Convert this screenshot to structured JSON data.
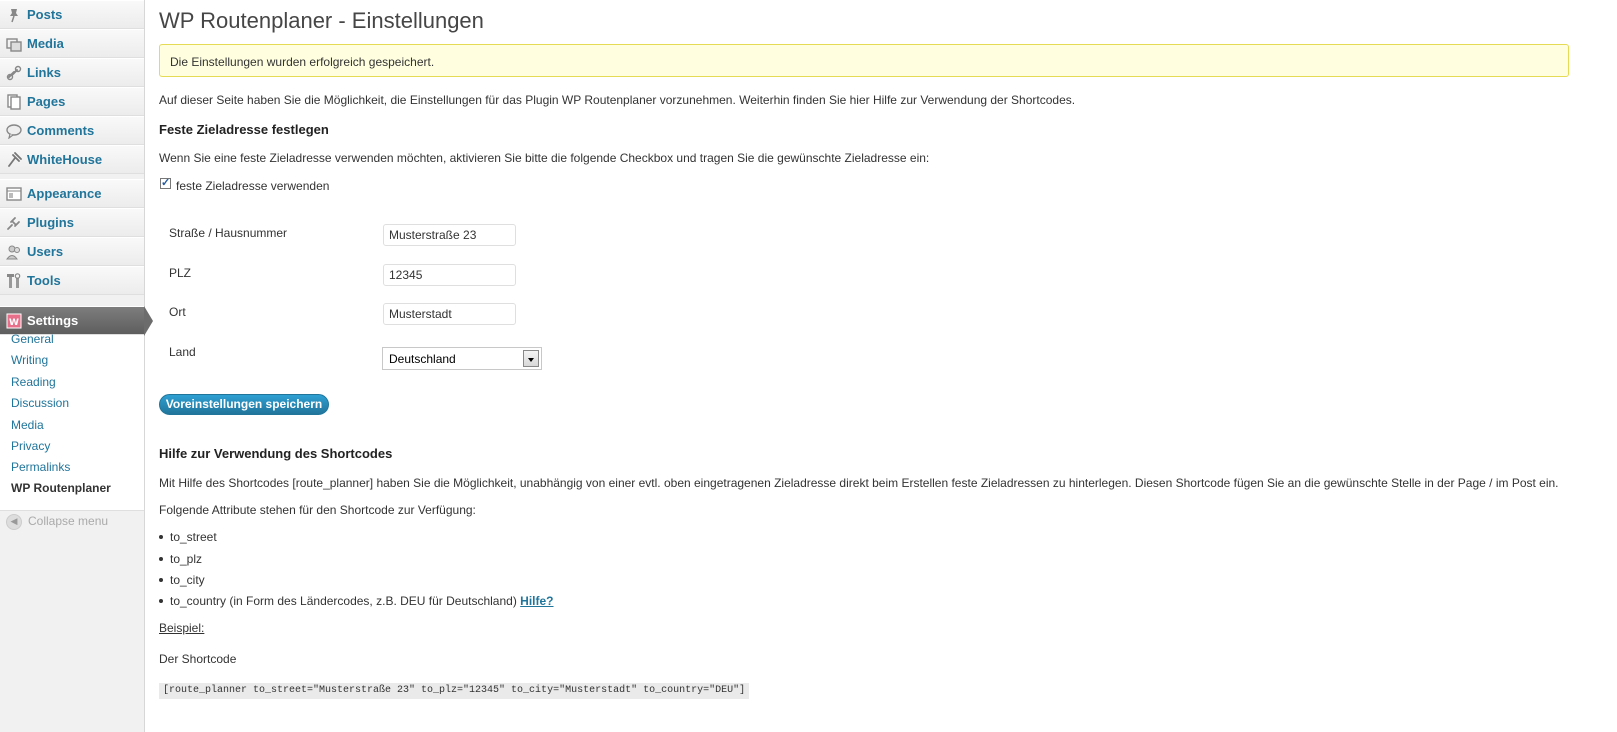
{
  "sidebar": {
    "items": [
      {
        "label": "Posts",
        "icon": "pushpin-icon"
      },
      {
        "label": "Media",
        "icon": "media-icon"
      },
      {
        "label": "Links",
        "icon": "link-icon"
      },
      {
        "label": "Pages",
        "icon": "pages-icon"
      },
      {
        "label": "Comments",
        "icon": "comment-icon"
      },
      {
        "label": "WhiteHouse",
        "icon": "plugin-icon"
      },
      {
        "label": "Appearance",
        "icon": "appearance-icon"
      },
      {
        "label": "Plugins",
        "icon": "plug-icon"
      },
      {
        "label": "Users",
        "icon": "users-icon"
      },
      {
        "label": "Tools",
        "icon": "tools-icon"
      }
    ],
    "current": {
      "label": "Settings",
      "icon": "settings-icon"
    },
    "submenu": [
      "General",
      "Writing",
      "Reading",
      "Discussion",
      "Media",
      "Privacy",
      "Permalinks",
      "WP Routenplaner"
    ],
    "collapse_label": "Collapse menu"
  },
  "page": {
    "title": "WP Routenplaner - Einstellungen",
    "notice": "Die Einstellungen wurden erfolgreich gespeichert.",
    "intro": "Auf dieser Seite haben Sie die Möglichkeit, die Einstellungen für das Plugin WP Routenplaner vorzunehmen. Weiterhin finden Sie hier Hilfe zur Verwendung der Shortcodes.",
    "section1_title": "Feste Zieladresse festlegen",
    "section1_text": "Wenn Sie eine feste Zieladresse verwenden möchten, aktivieren Sie bitte die folgende Checkbox und tragen Sie die gewünschte Zieladresse ein:",
    "checkbox_label": "feste Zieladresse verwenden",
    "checkbox_checked": true,
    "form": {
      "street_label": "Straße / Hausnummer",
      "street_value": "Musterstraße 23",
      "plz_label": "PLZ",
      "plz_value": "12345",
      "city_label": "Ort",
      "city_value": "Musterstadt",
      "country_label": "Land",
      "country_value": "Deutschland"
    },
    "save_button": "Voreinstellungen speichern",
    "section2_title": "Hilfe zur Verwendung des Shortcodes",
    "section2_text": "Mit Hilfe des Shortcodes [route_planner] haben Sie die Möglichkeit, unabhängig von einer evtl. oben eingetragenen Zieladresse direkt beim Erstellen feste Zieladressen zu hinterlegen. Diesen Shortcode fügen Sie an die gewünschte Stelle in der Page / im Post ein.",
    "attributes_intro": "Folgende Attribute stehen für den Shortcode zur Verfügung:",
    "attributes": [
      "to_street",
      "to_plz",
      "to_city"
    ],
    "attribute_country": "to_country (in Form des Ländercodes, z.B. DEU für Deutschland)",
    "help_link": "Hilfe?",
    "example_label": "Beispiel:",
    "shortcode_label": "Der Shortcode",
    "shortcode_example": "[route_planner to_street=\"Musterstraße 23\" to_plz=\"12345\" to_city=\"Musterstadt\" to_country=\"DEU\"]"
  },
  "colors": {
    "link": "#21759b",
    "notice_bg": "#ffffe0",
    "notice_border": "#e6db55",
    "button": "#21759b",
    "current_menu": "#6c6c6c"
  }
}
